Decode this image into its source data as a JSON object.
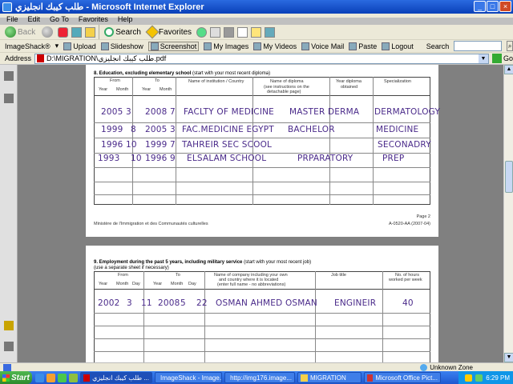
{
  "window": {
    "title": "طلب كيبك انجليزي - Microsoft Internet Explorer",
    "buttons": [
      "_",
      "□",
      "×"
    ]
  },
  "menu": [
    "File",
    "Edit",
    "Go To",
    "Favorites",
    "Help"
  ],
  "nav": {
    "back": "Back",
    "search": "Search",
    "favorites": "Favorites"
  },
  "links": {
    "imageshack": "ImageShack®",
    "upload": "Upload",
    "slideshow": "Slideshow",
    "screenshot": "Screenshot",
    "my_images": "My Images",
    "my_videos": "My Videos",
    "voice_mail": "Voice Mail",
    "paste": "Paste",
    "logout": "Logout",
    "search_label": "Search"
  },
  "address": {
    "label": "Address",
    "value": "D:\\MIGRATION\\طلب كيبك انجليزي.pdf",
    "go": "Go"
  },
  "form1": {
    "section": "8.  Education, excluding elementary school",
    "section_note": "(start with your most recent diploma)",
    "headers": {
      "from": "From",
      "to": "To",
      "year": "Year",
      "month": "Month",
      "institution": "Name of institution / Country",
      "diploma": "Name of diploma",
      "diploma_note": "(see instructions on the",
      "diploma_note2": "detachable page)",
      "year_obtained": "Year diploma",
      "year_obtained2": "obtained",
      "specialization": "Specialization"
    },
    "rows": [
      {
        "from_year": "2005",
        "from_month": "3",
        "to_year": "2008",
        "to_month": "7",
        "institution": "FACLTY OF MEDICINE",
        "diploma": "MASTER DERMA",
        "specialization": "DERMATOLOGY"
      },
      {
        "from_year": "1999",
        "from_month": "8",
        "to_year": "2005",
        "to_month": "3",
        "institution": "FAC.MEDICINE  EGYPT",
        "diploma": "BACHELOR",
        "specialization": "MEDICINE"
      },
      {
        "from_year": "1996",
        "from_month": "10",
        "to_year": "1999",
        "to_month": "7",
        "institution": "TAHREIR  SEC SCOOL",
        "diploma": "",
        "specialization": "SECONADRY"
      },
      {
        "from_year": "1993",
        "from_month": "10",
        "to_year": "1996",
        "to_month": "9",
        "institution": "ELSALAM    SCHOOL",
        "diploma": "PRPARATORY",
        "specialization": "PREP"
      }
    ],
    "page_num": "Page 2",
    "ministry": "Ministère de l'Immigration et des Communautés culturelles",
    "form_code": "A-0520-AA (2007-04)"
  },
  "form2": {
    "section": "9.  Employment during the past 5 years, including military service",
    "section_note": "(start with your most recent job)",
    "section_note2": "(use a separate sheet if necessary)",
    "headers": {
      "from": "From",
      "to": "To",
      "year": "Year",
      "month": "Month",
      "day": "Day",
      "company": "Name of company including your own",
      "company2": "and country where it is located",
      "company3": "(enter full name - no abbreviations)",
      "job": "Job title",
      "hours": "No. of hours",
      "hours2": "worked per week"
    },
    "rows": [
      {
        "from_year": "2002",
        "from_month": "3",
        "from_day": "11",
        "to_year": "2008",
        "to_month": "5",
        "to_day": "22",
        "company": "OSMAN AHMED OSMAN",
        "job": "ENGINEIR",
        "hours": "40"
      }
    ]
  },
  "status": {
    "zone": "Unknown Zone"
  },
  "taskbar": {
    "start": "Start",
    "tasks": [
      "طلب كيبك انجليزي ...",
      "ImageShack - Image...",
      "http://img176.image...",
      "MIGRATION",
      "Microsoft Office Pict..."
    ],
    "clock": "6:29 PM"
  }
}
